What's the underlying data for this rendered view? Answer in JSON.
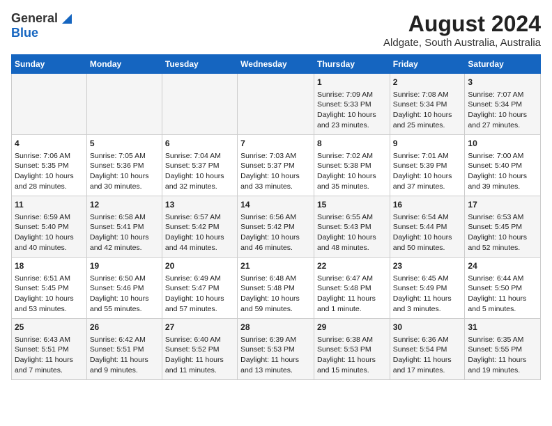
{
  "header": {
    "logo_general": "General",
    "logo_blue": "Blue",
    "month": "August 2024",
    "location": "Aldgate, South Australia, Australia"
  },
  "days_of_week": [
    "Sunday",
    "Monday",
    "Tuesday",
    "Wednesday",
    "Thursday",
    "Friday",
    "Saturday"
  ],
  "weeks": [
    [
      {
        "day": "",
        "content": ""
      },
      {
        "day": "",
        "content": ""
      },
      {
        "day": "",
        "content": ""
      },
      {
        "day": "",
        "content": ""
      },
      {
        "day": "1",
        "content": "Sunrise: 7:09 AM\nSunset: 5:33 PM\nDaylight: 10 hours and 23 minutes."
      },
      {
        "day": "2",
        "content": "Sunrise: 7:08 AM\nSunset: 5:34 PM\nDaylight: 10 hours and 25 minutes."
      },
      {
        "day": "3",
        "content": "Sunrise: 7:07 AM\nSunset: 5:34 PM\nDaylight: 10 hours and 27 minutes."
      }
    ],
    [
      {
        "day": "4",
        "content": "Sunrise: 7:06 AM\nSunset: 5:35 PM\nDaylight: 10 hours and 28 minutes."
      },
      {
        "day": "5",
        "content": "Sunrise: 7:05 AM\nSunset: 5:36 PM\nDaylight: 10 hours and 30 minutes."
      },
      {
        "day": "6",
        "content": "Sunrise: 7:04 AM\nSunset: 5:37 PM\nDaylight: 10 hours and 32 minutes."
      },
      {
        "day": "7",
        "content": "Sunrise: 7:03 AM\nSunset: 5:37 PM\nDaylight: 10 hours and 33 minutes."
      },
      {
        "day": "8",
        "content": "Sunrise: 7:02 AM\nSunset: 5:38 PM\nDaylight: 10 hours and 35 minutes."
      },
      {
        "day": "9",
        "content": "Sunrise: 7:01 AM\nSunset: 5:39 PM\nDaylight: 10 hours and 37 minutes."
      },
      {
        "day": "10",
        "content": "Sunrise: 7:00 AM\nSunset: 5:40 PM\nDaylight: 10 hours and 39 minutes."
      }
    ],
    [
      {
        "day": "11",
        "content": "Sunrise: 6:59 AM\nSunset: 5:40 PM\nDaylight: 10 hours and 40 minutes."
      },
      {
        "day": "12",
        "content": "Sunrise: 6:58 AM\nSunset: 5:41 PM\nDaylight: 10 hours and 42 minutes."
      },
      {
        "day": "13",
        "content": "Sunrise: 6:57 AM\nSunset: 5:42 PM\nDaylight: 10 hours and 44 minutes."
      },
      {
        "day": "14",
        "content": "Sunrise: 6:56 AM\nSunset: 5:42 PM\nDaylight: 10 hours and 46 minutes."
      },
      {
        "day": "15",
        "content": "Sunrise: 6:55 AM\nSunset: 5:43 PM\nDaylight: 10 hours and 48 minutes."
      },
      {
        "day": "16",
        "content": "Sunrise: 6:54 AM\nSunset: 5:44 PM\nDaylight: 10 hours and 50 minutes."
      },
      {
        "day": "17",
        "content": "Sunrise: 6:53 AM\nSunset: 5:45 PM\nDaylight: 10 hours and 52 minutes."
      }
    ],
    [
      {
        "day": "18",
        "content": "Sunrise: 6:51 AM\nSunset: 5:45 PM\nDaylight: 10 hours and 53 minutes."
      },
      {
        "day": "19",
        "content": "Sunrise: 6:50 AM\nSunset: 5:46 PM\nDaylight: 10 hours and 55 minutes."
      },
      {
        "day": "20",
        "content": "Sunrise: 6:49 AM\nSunset: 5:47 PM\nDaylight: 10 hours and 57 minutes."
      },
      {
        "day": "21",
        "content": "Sunrise: 6:48 AM\nSunset: 5:48 PM\nDaylight: 10 hours and 59 minutes."
      },
      {
        "day": "22",
        "content": "Sunrise: 6:47 AM\nSunset: 5:48 PM\nDaylight: 11 hours and 1 minute."
      },
      {
        "day": "23",
        "content": "Sunrise: 6:45 AM\nSunset: 5:49 PM\nDaylight: 11 hours and 3 minutes."
      },
      {
        "day": "24",
        "content": "Sunrise: 6:44 AM\nSunset: 5:50 PM\nDaylight: 11 hours and 5 minutes."
      }
    ],
    [
      {
        "day": "25",
        "content": "Sunrise: 6:43 AM\nSunset: 5:51 PM\nDaylight: 11 hours and 7 minutes."
      },
      {
        "day": "26",
        "content": "Sunrise: 6:42 AM\nSunset: 5:51 PM\nDaylight: 11 hours and 9 minutes."
      },
      {
        "day": "27",
        "content": "Sunrise: 6:40 AM\nSunset: 5:52 PM\nDaylight: 11 hours and 11 minutes."
      },
      {
        "day": "28",
        "content": "Sunrise: 6:39 AM\nSunset: 5:53 PM\nDaylight: 11 hours and 13 minutes."
      },
      {
        "day": "29",
        "content": "Sunrise: 6:38 AM\nSunset: 5:53 PM\nDaylight: 11 hours and 15 minutes."
      },
      {
        "day": "30",
        "content": "Sunrise: 6:36 AM\nSunset: 5:54 PM\nDaylight: 11 hours and 17 minutes."
      },
      {
        "day": "31",
        "content": "Sunrise: 6:35 AM\nSunset: 5:55 PM\nDaylight: 11 hours and 19 minutes."
      }
    ]
  ]
}
